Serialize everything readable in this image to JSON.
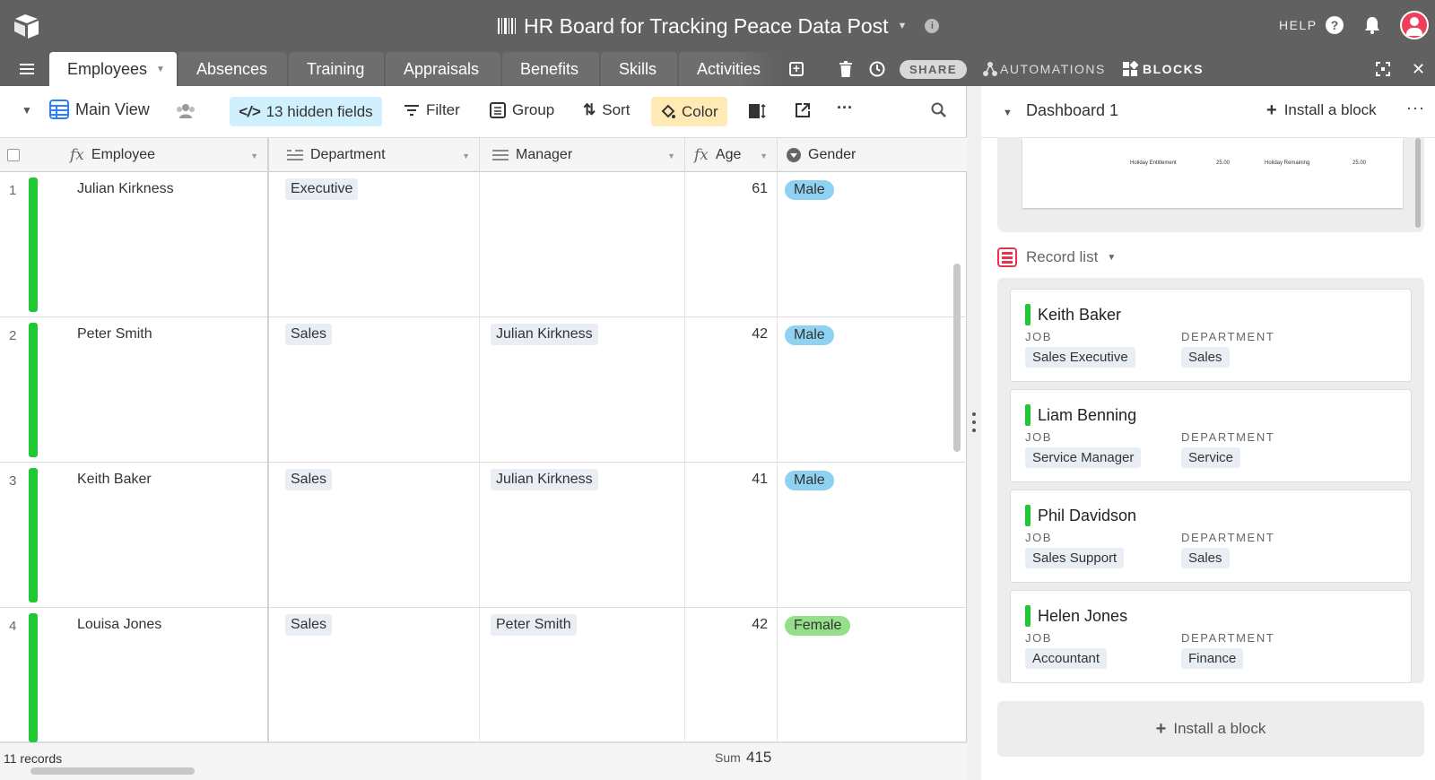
{
  "topbar": {
    "base_title": "HR Board for Tracking Peace Data Post",
    "help": "HELP"
  },
  "tabs": [
    {
      "label": "Employees",
      "active": true
    },
    {
      "label": "Absences"
    },
    {
      "label": "Training"
    },
    {
      "label": "Appraisals"
    },
    {
      "label": "Benefits"
    },
    {
      "label": "Skills"
    },
    {
      "label": "Activities"
    }
  ],
  "tabbar": {
    "share": "SHARE",
    "automations": "AUTOMATIONS",
    "blocks": "BLOCKS"
  },
  "viewbar": {
    "view_name": "Main View",
    "hidden_fields": "13 hidden fields",
    "filter": "Filter",
    "group": "Group",
    "sort": "Sort",
    "color": "Color"
  },
  "columns": {
    "employee": "Employee",
    "department": "Department",
    "manager": "Manager",
    "age": "Age",
    "gender": "Gender"
  },
  "rows": [
    {
      "num": "1",
      "employee": "Julian Kirkness",
      "department": "Executive",
      "manager": "",
      "age": "61",
      "gender": "Male"
    },
    {
      "num": "2",
      "employee": "Peter Smith",
      "department": "Sales",
      "manager": "Julian Kirkness",
      "age": "42",
      "gender": "Male"
    },
    {
      "num": "3",
      "employee": "Keith Baker",
      "department": "Sales",
      "manager": "Julian Kirkness",
      "age": "41",
      "gender": "Male"
    },
    {
      "num": "4",
      "employee": "Louisa Jones",
      "department": "Sales",
      "manager": "Peter Smith",
      "age": "42",
      "gender": "Female"
    }
  ],
  "footer": {
    "records": "11 records",
    "sum_label": "Sum",
    "sum_value": "415"
  },
  "colors": {
    "row_bar": "#20c933",
    "male": "#8ed1f0",
    "female": "#93e088",
    "hidden_fields_bg": "#d0f0fd",
    "color_bg": "#ffeab6"
  },
  "dashboard": {
    "title": "Dashboard 1",
    "install_block": "Install a block",
    "preview": {
      "label1": "Holiday Entitlement",
      "value1": "25.00",
      "label2": "Holiday Remaining",
      "value2": "25.00"
    },
    "record_list_title": "Record list",
    "job_label": "JOB",
    "dept_label": "DEPARTMENT",
    "cards": [
      {
        "name": "Keith Baker",
        "job": "Sales Executive",
        "department": "Sales"
      },
      {
        "name": "Liam Benning",
        "job": "Service Manager",
        "department": "Service"
      },
      {
        "name": "Phil Davidson",
        "job": "Sales Support",
        "department": "Sales"
      },
      {
        "name": "Helen Jones",
        "job": "Accountant",
        "department": "Finance"
      }
    ],
    "install_bottom": "Install a block"
  }
}
